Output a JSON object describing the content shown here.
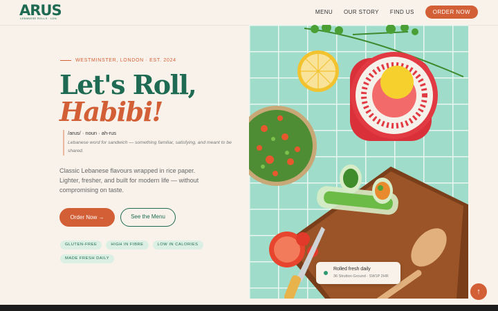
{
  "brand": {
    "logo_text": "ARUS",
    "logo_tagline": "LEBANESE ROLLS · LDN"
  },
  "nav": {
    "links": [
      "MENU",
      "OUR STORY",
      "FIND US"
    ],
    "cta": "ORDER NOW"
  },
  "hero": {
    "eyebrow": "WESTMINSTER, LONDON · EST. 2024",
    "title_line1": "Let's Roll,",
    "title_line2": "Habibi!",
    "definition_head": "/arus/ · noun · ah-rus",
    "definition_body": "Lebanese word for sandwich — something familiar, satisfying, and meant to be shared.",
    "lead": "Classic Lebanese flavours wrapped in rice paper. Lighter, fresher, and built for modern life — without compromising on taste.",
    "primary_button": "Order Now →",
    "secondary_button": "See the Menu",
    "tags": [
      "GLUTEN-FREE",
      "HIGH IN FIBRE",
      "LOW IN CALORIES",
      "MADE FRESH DAILY"
    ]
  },
  "info_card": {
    "title": "Rolled fresh daily",
    "subtitle": "36 Strutton Ground · SW1P 2HR"
  },
  "scroll_top": "↑",
  "colors": {
    "brand_green": "#1e6a52",
    "accent_orange": "#d35f36",
    "background": "#f8f2ea",
    "tile_mint": "#9fdcc9"
  }
}
